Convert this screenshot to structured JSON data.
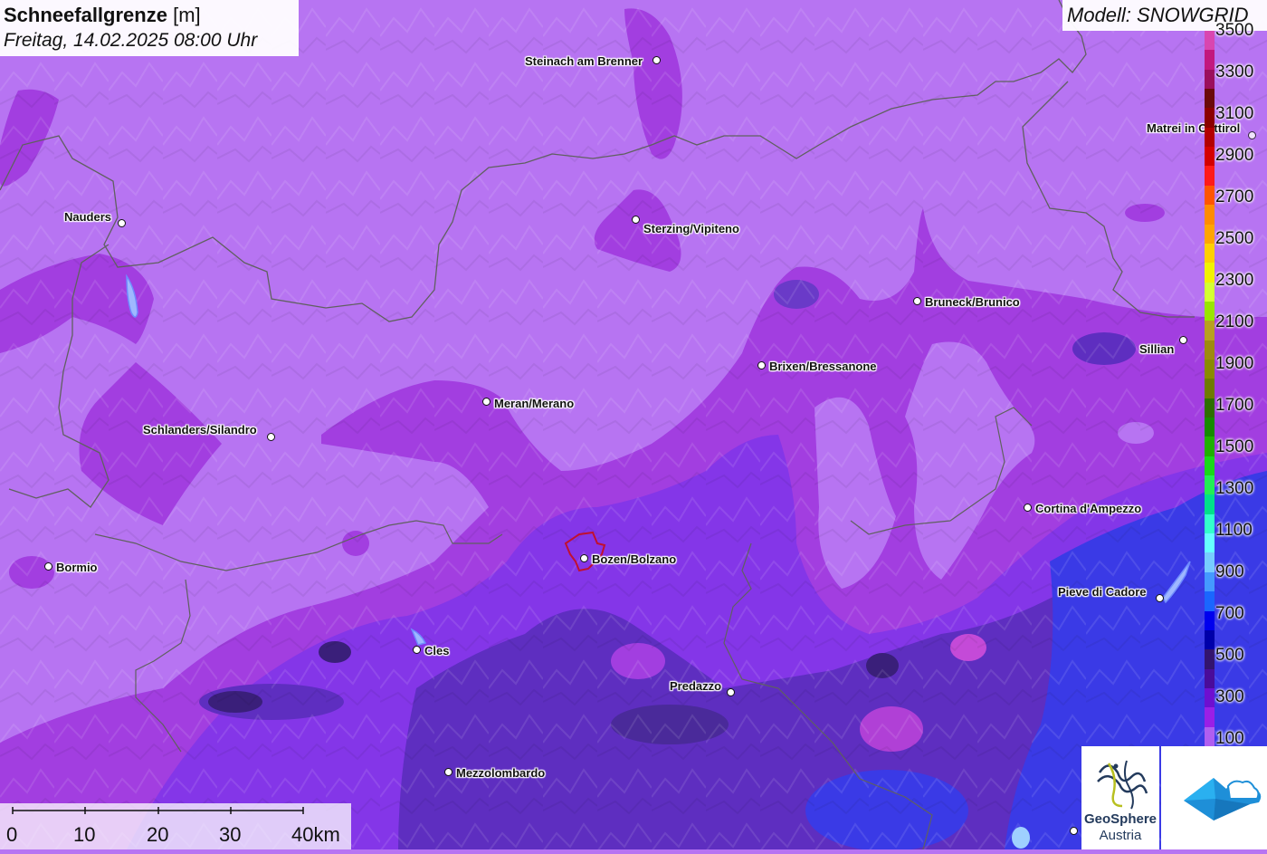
{
  "title": {
    "parameter": "Schneefallgrenze",
    "unit": "[m]",
    "datetime": "Freitag, 14.02.2025 08:00 Uhr"
  },
  "model": "Modell: SNOWGRID",
  "cities": [
    {
      "name": "Steinach am Brenner"
    },
    {
      "name": "Nauders"
    },
    {
      "name": "Sterzing/Vipiteno"
    },
    {
      "name": "Matrei in Osttirol"
    },
    {
      "name": "Bruneck/Brunico"
    },
    {
      "name": "Sillian"
    },
    {
      "name": "Brixen/Bressanone"
    },
    {
      "name": "Meran/Merano"
    },
    {
      "name": "Schlanders/Silandro"
    },
    {
      "name": "Cortina d'Ampezzo"
    },
    {
      "name": "Bormio"
    },
    {
      "name": "Bozen/Bolzano"
    },
    {
      "name": "Pieve di Cadore"
    },
    {
      "name": "Cles"
    },
    {
      "name": "Predazzo"
    },
    {
      "name": "Mezzolombardo"
    }
  ],
  "legend": {
    "labels": [
      "3500",
      "3300",
      "3100",
      "2900",
      "2700",
      "2500",
      "2300",
      "2100",
      "1900",
      "1700",
      "1500",
      "1300",
      "1100",
      "900",
      "700",
      "500",
      "300",
      "100"
    ],
    "colors": [
      "#d946b0",
      "#c2187e",
      "#9b0f5c",
      "#6a0a0a",
      "#8b0000",
      "#b30000",
      "#d40000",
      "#ff1a1a",
      "#ff5500",
      "#ff8c00",
      "#ffa500",
      "#ffd000",
      "#f2f200",
      "#d4ff33",
      "#99e600",
      "#b8a020",
      "#9e8a10",
      "#8a8a00",
      "#6f7a00",
      "#2e6e00",
      "#168a00",
      "#20b000",
      "#19d919",
      "#22ee55",
      "#00e08a",
      "#33ffcc",
      "#66ffff",
      "#77ccff",
      "#4499ff",
      "#1a66ff",
      "#0000ee",
      "#0000aa",
      "#33146e",
      "#4a0c9a",
      "#6e0fd0",
      "#9a1fe6",
      "#b05ef0"
    ]
  },
  "scale": {
    "labels": [
      "0",
      "10",
      "20",
      "30",
      "40km"
    ]
  },
  "logos": {
    "geosphere_line1": "GeoSphere",
    "geosphere_line2": "Austria"
  },
  "colors": {
    "background": "#b774f2",
    "magenta_zone": "#a23ee0",
    "purple_zone": "#8436e8",
    "deep_zone": "#5e2ec0",
    "dark_zone": "#4a2a9a",
    "blue_zone": "#3a3ae6",
    "border": "#606060"
  }
}
